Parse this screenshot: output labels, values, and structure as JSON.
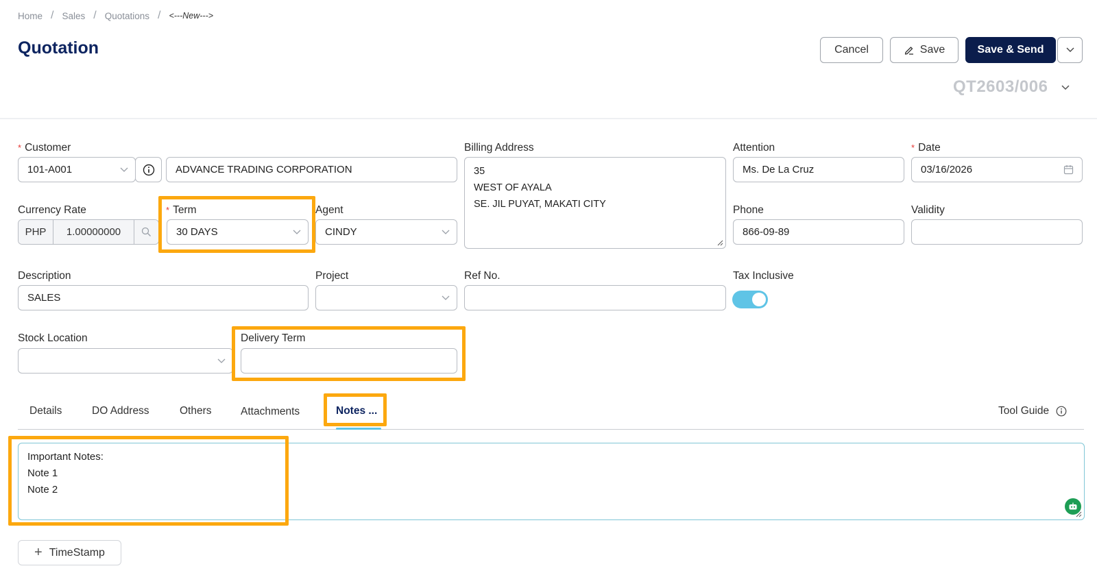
{
  "breadcrumb": {
    "home": "Home",
    "sales": "Sales",
    "quotations": "Quotations",
    "current": "<---New--->"
  },
  "title": "Quotation",
  "buttons": {
    "cancel": "Cancel",
    "save": "Save",
    "save_send": "Save & Send"
  },
  "doc_number": "QT2603/006",
  "form": {
    "customer_label": "Customer",
    "customer_code": "101-A001",
    "customer_name": "ADVANCE TRADING CORPORATION",
    "billing_address_label": "Billing Address",
    "billing_address_lines": [
      "35",
      "WEST OF AYALA",
      "SE. JIL PUYAT, MAKATI CITY"
    ],
    "attention_label": "Attention",
    "attention_value": "Ms. De La Cruz",
    "date_label": "Date",
    "date_value": "03/16/2026",
    "currency_rate_label": "Currency Rate",
    "currency_code": "PHP",
    "currency_rate": "1.00000000",
    "term_label": "Term",
    "term_value": "30 DAYS",
    "agent_label": "Agent",
    "agent_value": "CINDY",
    "phone_label": "Phone",
    "phone_value": "866-09-89",
    "validity_label": "Validity",
    "validity_value": "",
    "description_label": "Description",
    "description_value": "SALES",
    "project_label": "Project",
    "project_value": "",
    "ref_no_label": "Ref No.",
    "ref_no_value": "",
    "tax_inclusive_label": "Tax Inclusive",
    "tax_inclusive": true,
    "stock_location_label": "Stock Location",
    "stock_location_value": "",
    "delivery_term_label": "Delivery Term",
    "delivery_term_value": ""
  },
  "tabs": [
    "Details",
    "DO Address",
    "Others",
    "Attachments",
    "Notes ..."
  ],
  "active_tab": "Notes ...",
  "tool_guide": "Tool Guide",
  "notes_lines": [
    "Important Notes:",
    "Note 1",
    "Note 2"
  ],
  "timestamp_label": "TimeStamp",
  "colors": {
    "primary": "#0b1d4c",
    "title": "#0d2460",
    "accent": "#5fc4e6",
    "highlight": "#fca80f",
    "required": "#e53935"
  }
}
